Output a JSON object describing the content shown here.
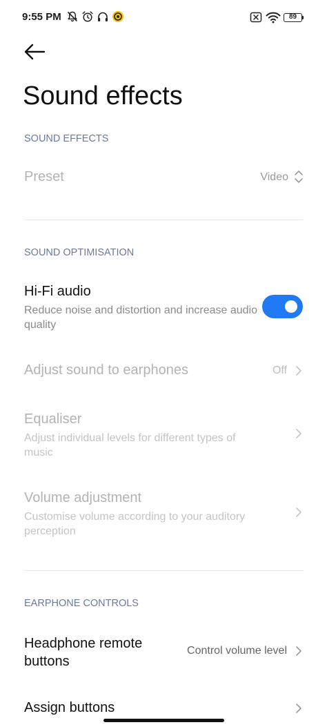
{
  "status_bar": {
    "time": "9:55 PM",
    "battery_level": "89",
    "icons_left": [
      "notifications-muted-icon",
      "alarm-icon",
      "headphones-icon",
      "app-notification-icon"
    ],
    "icons_right": [
      "sim-blocked-icon",
      "wifi-icon",
      "battery-icon"
    ]
  },
  "header": {
    "back_icon": "arrow-left-icon",
    "title": "Sound effects"
  },
  "sections": {
    "sound_effects": {
      "header": "SOUND EFFECTS",
      "preset": {
        "title": "Preset",
        "value": "Video",
        "enabled": false
      }
    },
    "sound_optimisation": {
      "header": "SOUND OPTIMISATION",
      "hifi": {
        "title": "Hi-Fi audio",
        "summary": "Reduce noise and distortion and increase audio quality",
        "toggle_on": true
      },
      "adjust_earphones": {
        "title": "Adjust sound to earphones",
        "value": "Off",
        "enabled": false
      },
      "equaliser": {
        "title": "Equaliser",
        "summary": "Adjust individual levels for different types of music",
        "enabled": false
      },
      "volume_adjustment": {
        "title": "Volume adjustment",
        "summary": "Customise volume according to your auditory perception",
        "enabled": false
      }
    },
    "earphone_controls": {
      "header": "EARPHONE CONTROLS",
      "remote_buttons": {
        "title": "Headphone remote buttons",
        "value": "Control volume level"
      },
      "assign_buttons": {
        "title": "Assign buttons"
      }
    }
  },
  "colors": {
    "accent": "#1f7af3",
    "section_header": "#6b7a99",
    "disabled_text": "#b3b3b3"
  }
}
